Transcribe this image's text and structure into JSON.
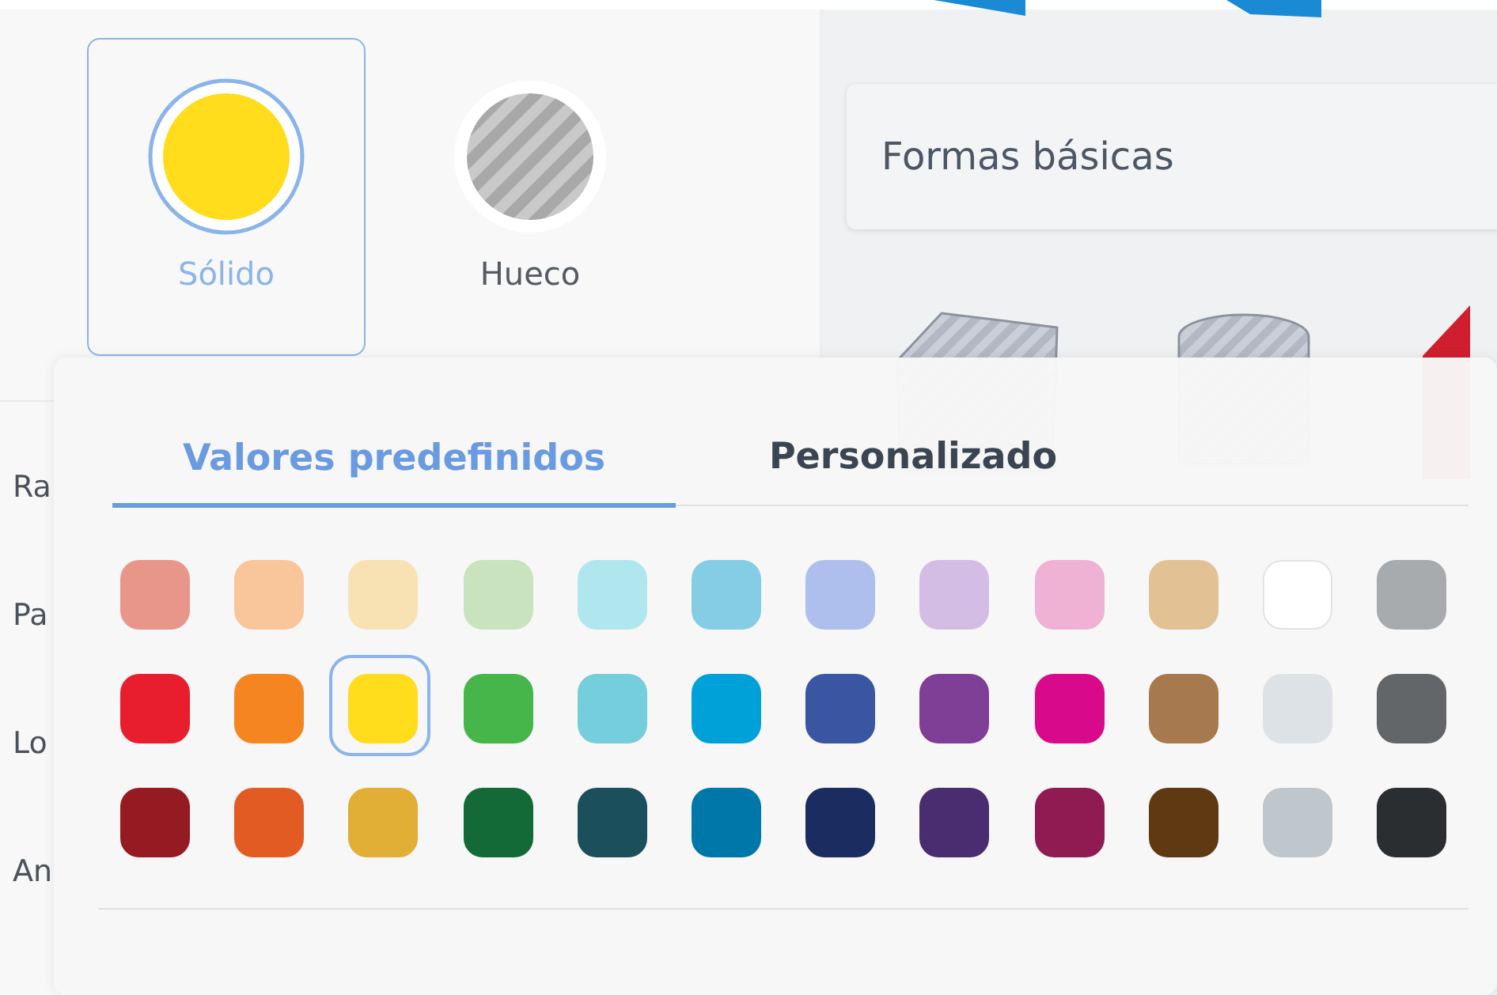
{
  "style_options": [
    {
      "label": "Sólido",
      "kind": "solid",
      "selected": true
    },
    {
      "label": "Hueco",
      "kind": "hollow",
      "selected": false
    }
  ],
  "property_labels": [
    "Ra",
    "Pa",
    "Lo",
    "An"
  ],
  "shape_category": {
    "value": "Formas básicas"
  },
  "color_picker": {
    "tabs": [
      {
        "label": "Valores predefinidos",
        "selected": true
      },
      {
        "label": "Personalizado",
        "selected": false
      }
    ],
    "rows": [
      {
        "swatches": [
          {
            "color": "#e8968a",
            "selected": false
          },
          {
            "color": "#f9c59a",
            "selected": false
          },
          {
            "color": "#f8e2b4",
            "selected": false
          },
          {
            "color": "#c8e3bd",
            "selected": false
          },
          {
            "color": "#b0e7ee",
            "selected": false
          },
          {
            "color": "#85cde5",
            "selected": false
          },
          {
            "color": "#aebfee",
            "selected": false
          },
          {
            "color": "#d4bde5",
            "selected": false
          },
          {
            "color": "#efb1d4",
            "selected": false
          },
          {
            "color": "#e2c194",
            "selected": false
          },
          {
            "color": "#ffffff",
            "selected": false
          },
          {
            "color": "#a7abae",
            "selected": false
          }
        ]
      },
      {
        "swatches": [
          {
            "color": "#e81e2e",
            "selected": false
          },
          {
            "color": "#f58520",
            "selected": false
          },
          {
            "color": "#ffdc1c",
            "selected": true
          },
          {
            "color": "#47b64a",
            "selected": false
          },
          {
            "color": "#74cedb",
            "selected": false
          },
          {
            "color": "#00a1d8",
            "selected": false
          },
          {
            "color": "#3a55a2",
            "selected": false
          },
          {
            "color": "#7f3f96",
            "selected": false
          },
          {
            "color": "#d8098b",
            "selected": false
          },
          {
            "color": "#a6794e",
            "selected": false
          },
          {
            "color": "#dce2e5",
            "selected": false
          },
          {
            "color": "#626669",
            "selected": false
          }
        ]
      },
      {
        "swatches": [
          {
            "color": "#961a22",
            "selected": false
          },
          {
            "color": "#e25b22",
            "selected": false
          },
          {
            "color": "#e1ae36",
            "selected": false
          },
          {
            "color": "#136a37",
            "selected": false
          },
          {
            "color": "#1b4f5b",
            "selected": false
          },
          {
            "color": "#0077a9",
            "selected": false
          },
          {
            "color": "#1a2c60",
            "selected": false
          },
          {
            "color": "#4a2d70",
            "selected": false
          },
          {
            "color": "#901b52",
            "selected": false
          },
          {
            "color": "#5e3912",
            "selected": false
          },
          {
            "color": "#bfc6cc",
            "selected": false
          },
          {
            "color": "#2a2e31",
            "selected": false
          }
        ]
      }
    ]
  }
}
